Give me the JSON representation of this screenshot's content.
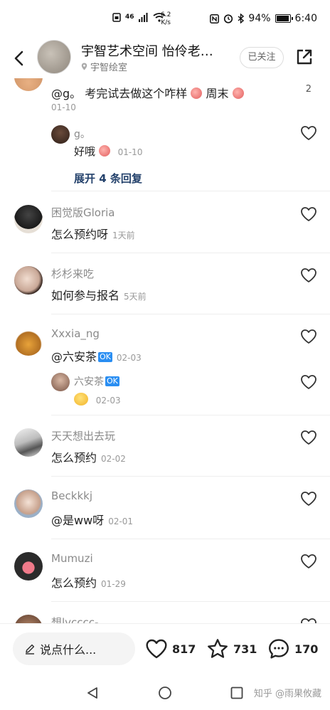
{
  "status_bar": {
    "network": "46",
    "net_speed": "6.2",
    "net_speed_unit": "K/s",
    "battery": "94%",
    "time": "6:40",
    "icons": [
      "nfc-icon",
      "alarm-icon",
      "bluetooth-icon",
      "battery-icon"
    ]
  },
  "header": {
    "title": "宇智艺术空间 怡伶老…",
    "subtitle": "宇智绘室",
    "follow_label": "已关注"
  },
  "comments": {
    "first": {
      "text": "@g。 考完试去做这个咋样",
      "text_tail": "周末",
      "date": "01-10",
      "count": "2",
      "reply": {
        "username": "g。",
        "text": "好哦",
        "date": "01-10"
      },
      "expand_label": "展开 4 条回复"
    },
    "items": [
      {
        "username": "困觉版Gloria",
        "text": "怎么预约呀",
        "date": "1天前"
      },
      {
        "username": "杉杉来吃",
        "text": "如何参与报名",
        "date": "5天前"
      },
      {
        "username": "Xxxia_ng",
        "text": "@六安茶",
        "tag": "OK",
        "date": "02-03",
        "reply": {
          "username": "六安茶",
          "tag": "OK",
          "date": "02-03"
        }
      },
      {
        "username": "天天想出去玩",
        "text": "怎么预约",
        "date": "02-02"
      },
      {
        "username": "Beckkkj",
        "text": "@是ww呀",
        "date": "02-01"
      },
      {
        "username": "Mumuzi",
        "text": "怎么预约",
        "date": "01-29"
      },
      {
        "username": "想lvcccc-",
        "text": "",
        "date": ""
      }
    ]
  },
  "bottom_bar": {
    "input_placeholder": "说点什么...",
    "likes": "817",
    "stars": "731",
    "comments": "170"
  },
  "watermark": "知乎 @雨果攸藏",
  "colors": {
    "link_blue": "#23416b",
    "tag_blue": "#2a8ef2",
    "muted_gray": "#8a8a8a"
  }
}
